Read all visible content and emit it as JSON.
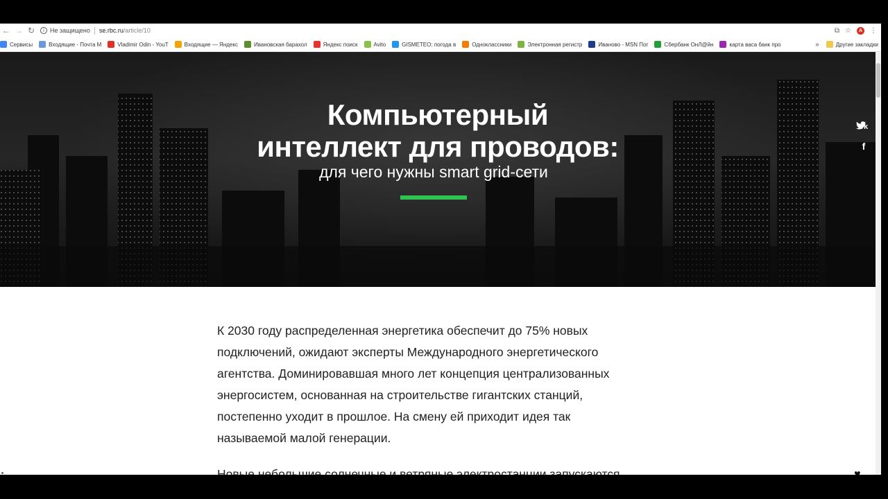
{
  "browser": {
    "secure_label": "Не защищено",
    "url_host": "se.rbc.ru",
    "url_path": "/article/10",
    "bookmarks": [
      {
        "label": "Сервисы",
        "color": "#4285f4"
      },
      {
        "label": "Входящие - Почта М",
        "color": "#6a9ad8"
      },
      {
        "label": "Vladimir Odin - YouT",
        "color": "#e52d27"
      },
      {
        "label": "Входящие — Яндекс",
        "color": "#f4a300"
      },
      {
        "label": "Ивановская барахол",
        "color": "#5a8f2e"
      },
      {
        "label": "Яндекс поиск",
        "color": "#e8322b"
      },
      {
        "label": "Avito",
        "color": "#8bc34a"
      },
      {
        "label": "GISMETEO: погода в",
        "color": "#2196f3"
      },
      {
        "label": "Одноклассники",
        "color": "#f57c00"
      },
      {
        "label": "Электронная регистр",
        "color": "#7cb342"
      },
      {
        "label": "Иваново - MSN Пог",
        "color": "#1e3c8c"
      },
      {
        "label": "Сбербанк ОнЛ@йн",
        "color": "#21a038"
      },
      {
        "label": "карта васа банк про",
        "color": "#9c27b0"
      }
    ],
    "more_label": "»",
    "other_bookmarks": "Другие закладки"
  },
  "hero": {
    "title_line1": "Компьютерный",
    "title_line2": "интеллект для проводов:",
    "subtitle": "для чего нужны smart grid-сети",
    "accent_color": "#2fc24f"
  },
  "share": {
    "vk": "vk",
    "facebook": "f",
    "twitter": "twitter"
  },
  "article": {
    "paragraph1_lines": [
      "К 2030 году распределенная энергетика обеспечит до 75% новых",
      "подключений, ожидают эксперты Международного энергетического",
      "агентства. Доминировавшая много лет концепция централизованных",
      "энергосистем, основанная на строительстве гигантских станций,",
      "постепенно уходит в прошлое. На смену ей приходит идея так",
      "называемой малой генерации."
    ],
    "paragraph2_start": "Новые небольшие солнечные и ветряные электростанции запускаются"
  }
}
